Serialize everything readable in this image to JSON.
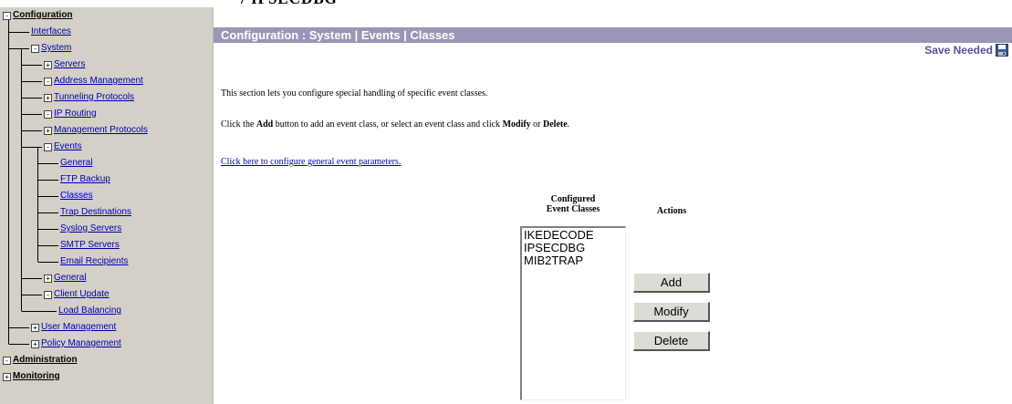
{
  "clipped_heading": "/ IPSECDBG",
  "sidebar": {
    "nodes": [
      {
        "label": "Configuration",
        "box": "-",
        "bold": true
      },
      {
        "label": "Interfaces",
        "box": ""
      },
      {
        "label": "System",
        "box": "-"
      },
      {
        "label": "Servers",
        "box": "+"
      },
      {
        "label": "Address Management",
        "box": "-"
      },
      {
        "label": "Tunneling Protocols",
        "box": "+"
      },
      {
        "label": "IP Routing",
        "box": "-"
      },
      {
        "label": "Management Protocols",
        "box": "+"
      },
      {
        "label": "Events",
        "box": "-"
      },
      {
        "label": "General",
        "box": ""
      },
      {
        "label": "FTP Backup",
        "box": ""
      },
      {
        "label": "Classes",
        "box": "",
        "selected": true
      },
      {
        "label": "Trap Destinations",
        "box": ""
      },
      {
        "label": "Syslog Servers",
        "box": ""
      },
      {
        "label": "SMTP Servers",
        "box": ""
      },
      {
        "label": "Email Recipients",
        "box": ""
      },
      {
        "label": "General",
        "box": "+"
      },
      {
        "label": "Client Update",
        "box": "-"
      },
      {
        "label": "Load Balancing",
        "box": ""
      },
      {
        "label": "User Management",
        "box": "+"
      },
      {
        "label": "Policy Management",
        "box": "+"
      },
      {
        "label": "Administration",
        "box": "-",
        "bold": true
      },
      {
        "label": "Monitoring",
        "box": "+",
        "bold": true
      }
    ]
  },
  "main": {
    "title": "Configuration : System | Events | Classes",
    "save_needed": "Save Needed",
    "intro": "This section lets you configure special handling of specific event classes.",
    "instr_prefix": "Click the ",
    "instr_add": "Add",
    "instr_mid": " button to add an event class, or select an event class and click ",
    "instr_modify": "Modify",
    "instr_or": " or ",
    "instr_delete": "Delete",
    "instr_end": ".",
    "general_link": "Click here to configure general event parameters.",
    "col_classes_line1": "Configured",
    "col_classes_line2": "Event Classes",
    "col_actions": "Actions",
    "classes": [
      "IKEDECODE",
      "IPSECDBG",
      "MIB2TRAP"
    ],
    "buttons": {
      "add": "Add",
      "modify": "Modify",
      "delete": "Delete"
    }
  },
  "colors": {
    "title_bar": "#9b96b5",
    "sidebar_bg": "#d4d0c8",
    "link": "#0000a8",
    "save_needed": "#53519a"
  }
}
